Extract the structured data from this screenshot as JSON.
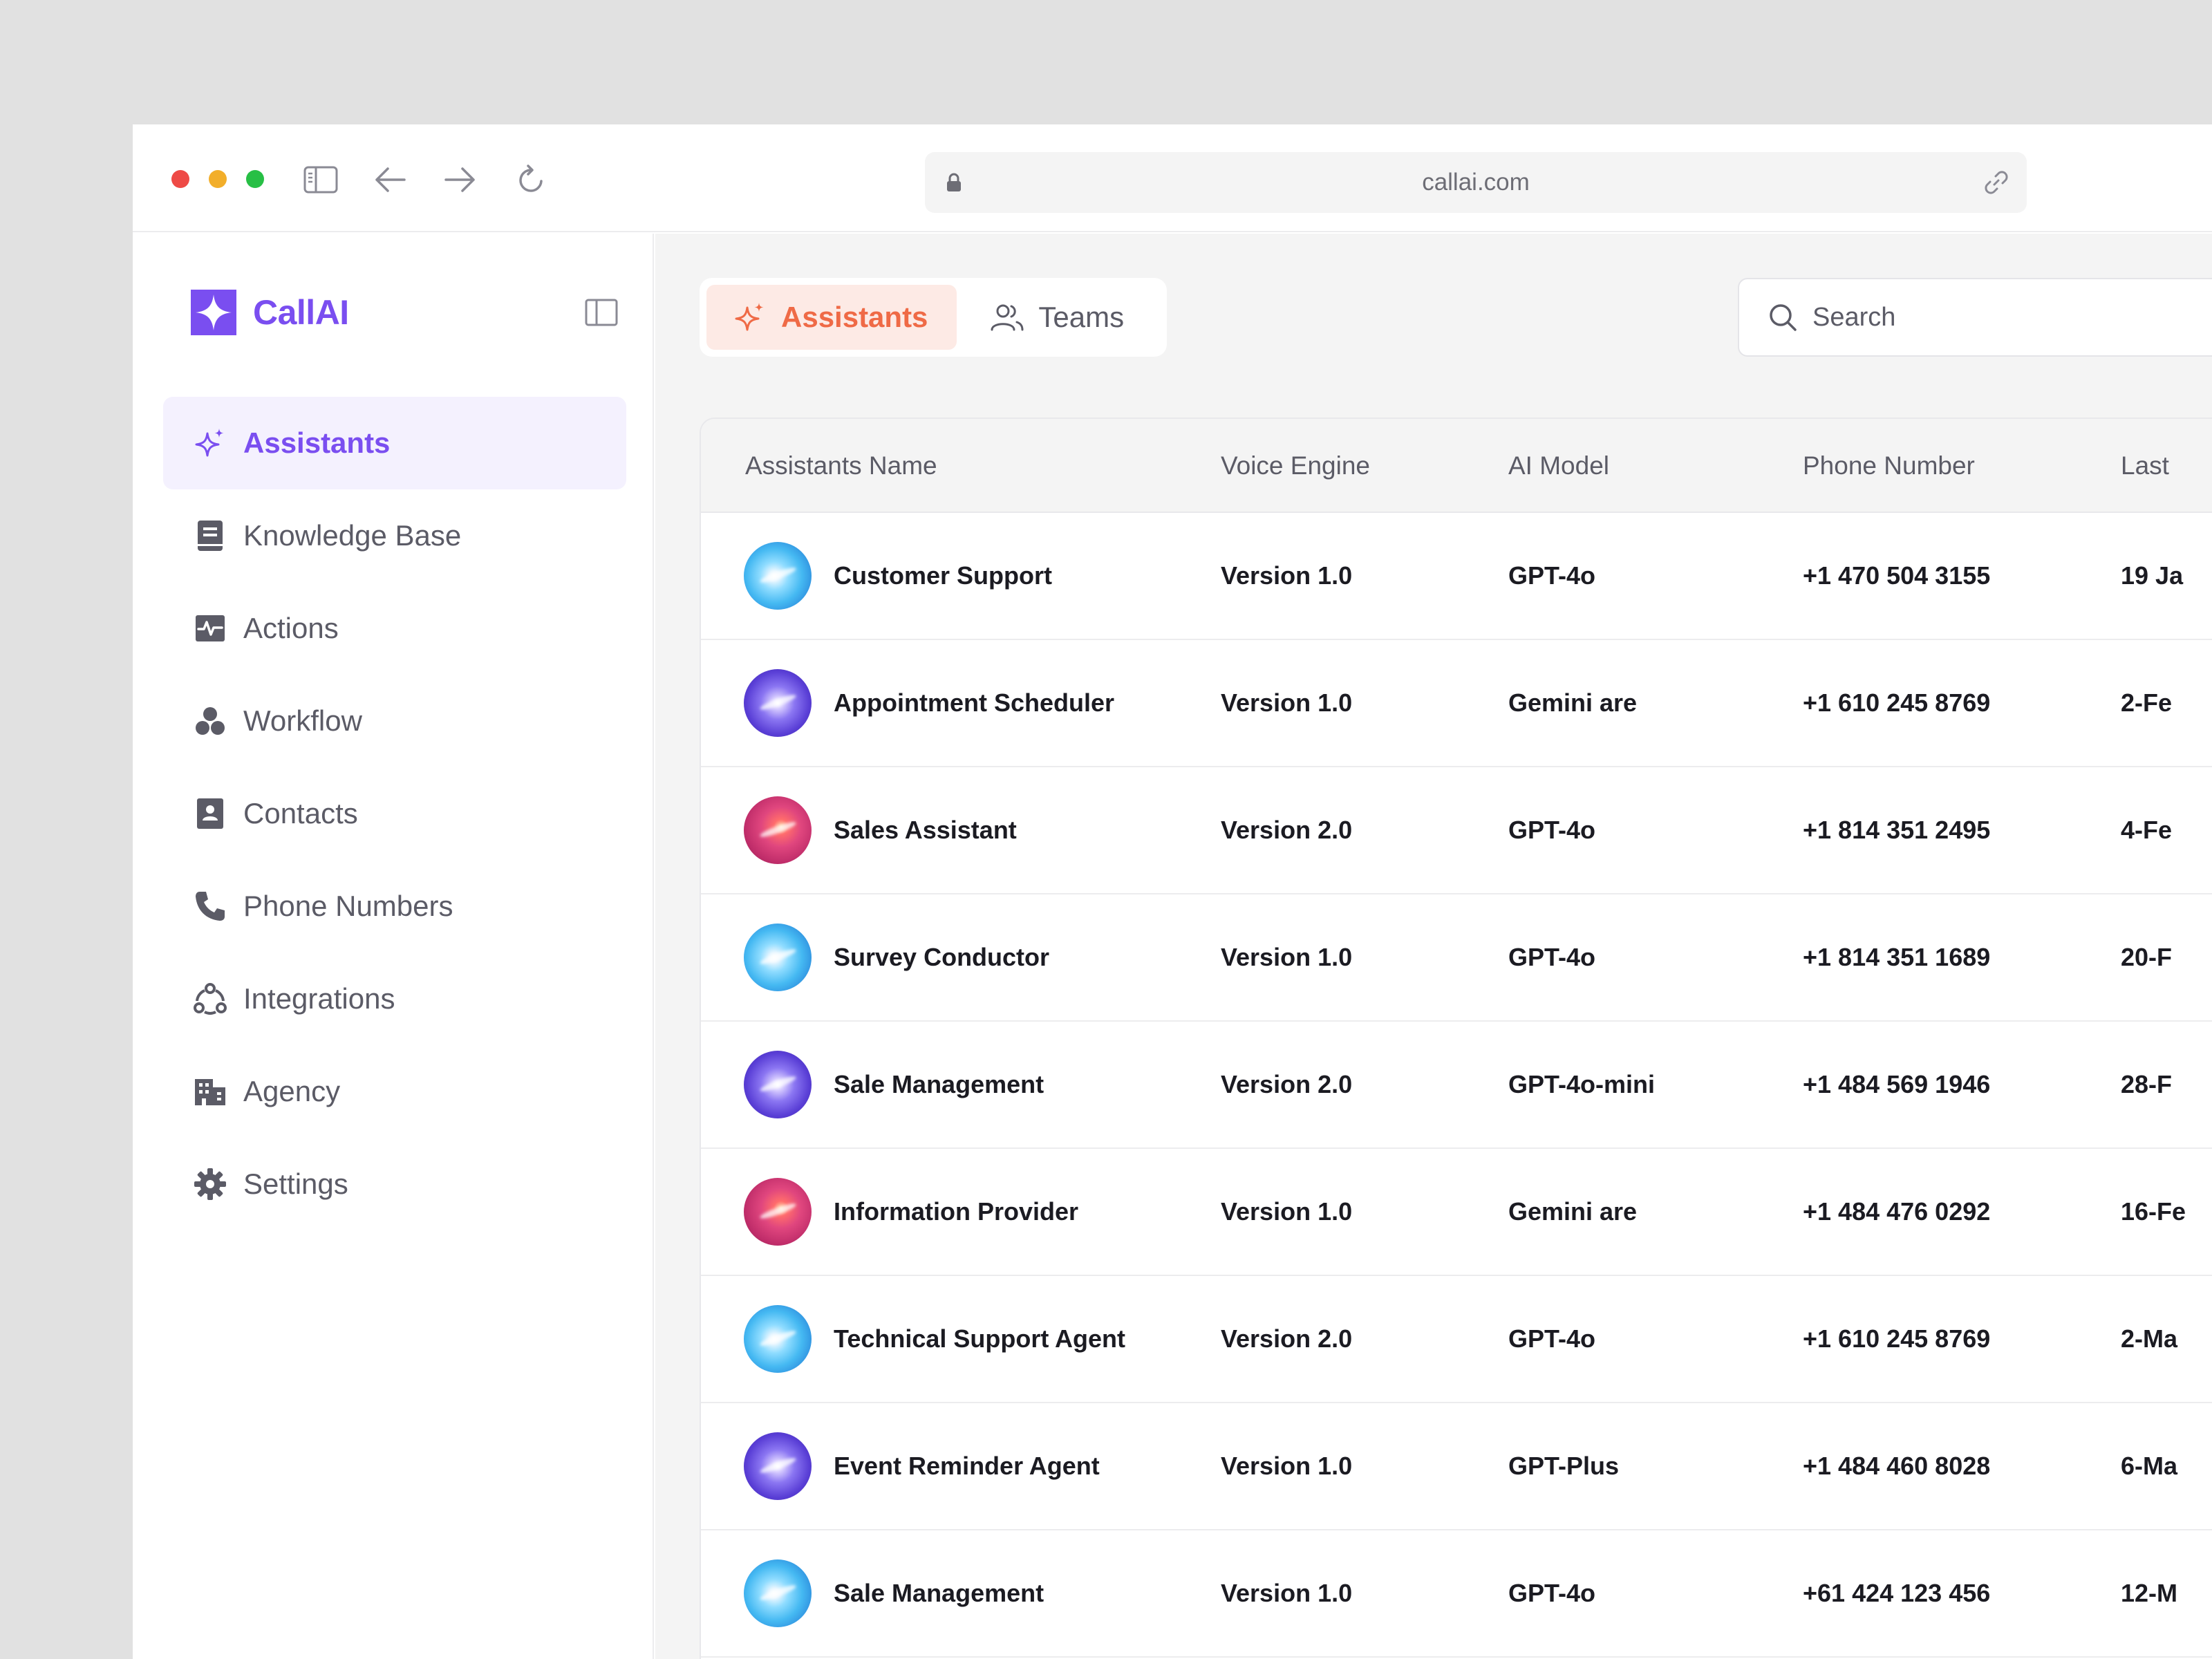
{
  "browser": {
    "url": "callai.com"
  },
  "brand": {
    "name": "CallAI",
    "color": "#7a4ef0"
  },
  "sidebar": {
    "items": [
      {
        "label": "Assistants",
        "icon": "sparkle-icon",
        "active": true
      },
      {
        "label": "Knowledge Base",
        "icon": "book-icon",
        "active": false
      },
      {
        "label": "Actions",
        "icon": "activity-icon",
        "active": false
      },
      {
        "label": "Workflow",
        "icon": "workflow-icon",
        "active": false
      },
      {
        "label": "Contacts",
        "icon": "contact-card-icon",
        "active": false
      },
      {
        "label": "Phone Numbers",
        "icon": "phone-icon",
        "active": false
      },
      {
        "label": "Integrations",
        "icon": "integrations-icon",
        "active": false
      },
      {
        "label": "Agency",
        "icon": "building-icon",
        "active": false
      },
      {
        "label": "Settings",
        "icon": "gear-icon",
        "active": false
      }
    ]
  },
  "tabs": [
    {
      "label": "Assistants",
      "icon": "sparkle-icon",
      "active": true
    },
    {
      "label": "Teams",
      "icon": "users-icon",
      "active": false
    }
  ],
  "search": {
    "placeholder": "Search"
  },
  "colors": {
    "accent_purple": "#7a4ef0",
    "accent_orange": "#ef6a46",
    "active_tab_bg": "#fdeae5",
    "active_nav_bg": "#f4f1fe"
  },
  "table": {
    "headers": [
      "Assistants Name",
      "Voice Engine",
      "AI Model",
      "Phone Number",
      "Last"
    ],
    "rows": [
      {
        "avatar": "blue",
        "name": "Customer Support",
        "voice_engine": "Version 1.0",
        "ai_model": "GPT-4o",
        "phone": "+1 470 504 3155",
        "last": "19 Ja"
      },
      {
        "avatar": "purple",
        "name": "Appointment Scheduler",
        "voice_engine": "Version 1.0",
        "ai_model": "Gemini are",
        "phone": "+1 610 245 8769",
        "last": "2-Fe"
      },
      {
        "avatar": "pink",
        "name": "Sales Assistant",
        "voice_engine": "Version 2.0",
        "ai_model": "GPT-4o",
        "phone": "+1 814 351 2495",
        "last": "4-Fe"
      },
      {
        "avatar": "blue",
        "name": "Survey Conductor",
        "voice_engine": "Version 1.0",
        "ai_model": "GPT-4o",
        "phone": "+1 814 351 1689",
        "last": "20-F"
      },
      {
        "avatar": "purple",
        "name": "Sale Management",
        "voice_engine": "Version 2.0",
        "ai_model": "GPT-4o-mini",
        "phone": "+1 484 569 1946",
        "last": "28-F"
      },
      {
        "avatar": "pink",
        "name": "Information Provider",
        "voice_engine": "Version 1.0",
        "ai_model": "Gemini are",
        "phone": "+1 484 476 0292",
        "last": "16-Fe"
      },
      {
        "avatar": "blue",
        "name": "Technical Support Agent",
        "voice_engine": "Version 2.0",
        "ai_model": "GPT-4o",
        "phone": "+1 610 245 8769",
        "last": "2-Ma"
      },
      {
        "avatar": "purple",
        "name": "Event Reminder Agent",
        "voice_engine": "Version 1.0",
        "ai_model": "GPT-Plus",
        "phone": "+1 484 460 8028",
        "last": "6-Ma"
      },
      {
        "avatar": "blue",
        "name": "Sale Management",
        "voice_engine": "Version 1.0",
        "ai_model": "GPT-4o",
        "phone": "+61 424 123 456",
        "last": "12-M"
      }
    ]
  }
}
